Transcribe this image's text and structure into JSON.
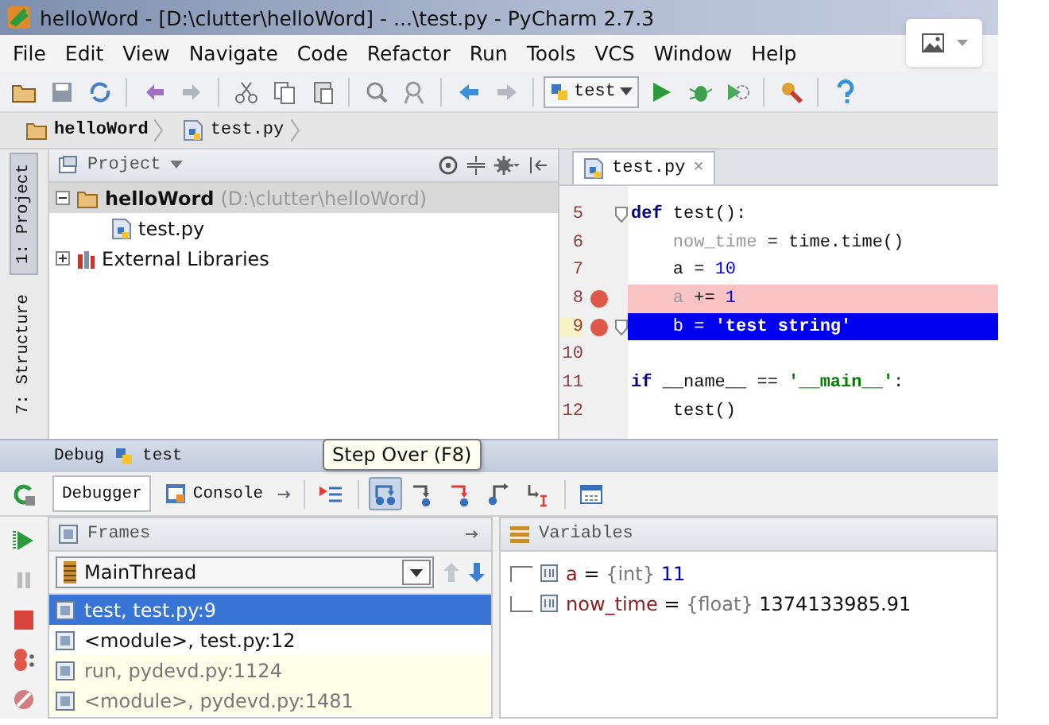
{
  "window": {
    "title": "helloWord - [D:\\clutter\\helloWord] - ...\\test.py - PyCharm 2.7.3"
  },
  "menu": [
    {
      "label": "File"
    },
    {
      "label": "Edit"
    },
    {
      "label": "View"
    },
    {
      "label": "Navigate"
    },
    {
      "label": "Code"
    },
    {
      "label": "Refactor"
    },
    {
      "label": "Run"
    },
    {
      "label": "Tools"
    },
    {
      "label": "VCS"
    },
    {
      "label": "Window"
    },
    {
      "label": "Help"
    }
  ],
  "toolbar": {
    "run_config": "test"
  },
  "breadcrumb": [
    {
      "label": "helloWord",
      "kind": "folder"
    },
    {
      "label": "test.py",
      "kind": "file"
    }
  ],
  "side_tabs": [
    {
      "label": "1: Project",
      "selected": true
    },
    {
      "label": "7: Structure",
      "selected": false
    }
  ],
  "project": {
    "title": "Project",
    "tree": [
      {
        "label": "helloWord",
        "detail": "(D:\\clutter\\helloWord)",
        "kind": "folder",
        "expanded": true,
        "selected": true,
        "children": [
          {
            "label": "test.py",
            "kind": "file",
            "selected": false
          }
        ]
      },
      {
        "label": "External Libraries",
        "kind": "library",
        "expanded": false,
        "selected": false
      }
    ]
  },
  "editor": {
    "tab": {
      "label": "test.py",
      "close": "×"
    },
    "lines": [
      {
        "number": "5",
        "fold": true,
        "breakpoint": false,
        "current": false,
        "segments": [
          {
            "text": "def",
            "kind": "keyword"
          },
          {
            "text": " test():",
            "kind": "plain"
          }
        ]
      },
      {
        "number": "6",
        "fold": false,
        "breakpoint": false,
        "current": false,
        "segments": [
          {
            "text": "    now_time",
            "kind": "unused"
          },
          {
            "text": " = time.time()",
            "kind": "plain"
          }
        ]
      },
      {
        "number": "7",
        "fold": false,
        "breakpoint": false,
        "current": false,
        "segments": [
          {
            "text": "    a = ",
            "kind": "plain"
          },
          {
            "text": "10",
            "kind": "number"
          }
        ]
      },
      {
        "number": "8",
        "fold": false,
        "breakpoint": true,
        "current": false,
        "segments": [
          {
            "text": "    a",
            "kind": "unused"
          },
          {
            "text": " += ",
            "kind": "plain"
          },
          {
            "text": "1",
            "kind": "number"
          }
        ]
      },
      {
        "number": "9",
        "fold": true,
        "breakpoint": true,
        "current": true,
        "segments": [
          {
            "text": "    b = ",
            "kind": "plain"
          },
          {
            "text": "'test string'",
            "kind": "string"
          }
        ]
      },
      {
        "number": "10",
        "fold": false,
        "breakpoint": false,
        "current": false
      },
      {
        "number": "11",
        "fold": false,
        "breakpoint": false,
        "current": false,
        "segments": [
          {
            "text": "if",
            "kind": "keyword"
          },
          {
            "text": " __name__ == ",
            "kind": "plain"
          },
          {
            "text": "'__main__'",
            "kind": "string"
          },
          {
            "text": ":",
            "kind": "plain"
          }
        ]
      },
      {
        "number": "12",
        "fold": false,
        "breakpoint": false,
        "current": false,
        "segments": [
          {
            "text": "    test()",
            "kind": "plain"
          }
        ]
      }
    ]
  },
  "debug": {
    "title": "Debug",
    "config": "test",
    "tooltip": "Step Over (F8)",
    "tabs": [
      {
        "label": "Debugger",
        "selected": true
      },
      {
        "label": "Console",
        "selected": false
      }
    ],
    "frames": {
      "title": "Frames",
      "thread": "MainThread",
      "items": [
        {
          "label": "test, test.py:9",
          "kind": "user",
          "selected": true
        },
        {
          "label": "<module>, test.py:12",
          "kind": "user",
          "selected": false
        },
        {
          "label": "run, pydevd.py:1124",
          "kind": "library",
          "selected": false
        },
        {
          "label": "<module>, pydevd.py:1481",
          "kind": "library",
          "selected": false
        }
      ]
    },
    "variables": {
      "title": "Variables",
      "items": [
        {
          "name": "a",
          "sign": "=",
          "type": "{int}",
          "value": "11"
        },
        {
          "name": "now_time",
          "sign": "=",
          "type": "{float}",
          "value": "1374133985.91"
        }
      ]
    }
  }
}
